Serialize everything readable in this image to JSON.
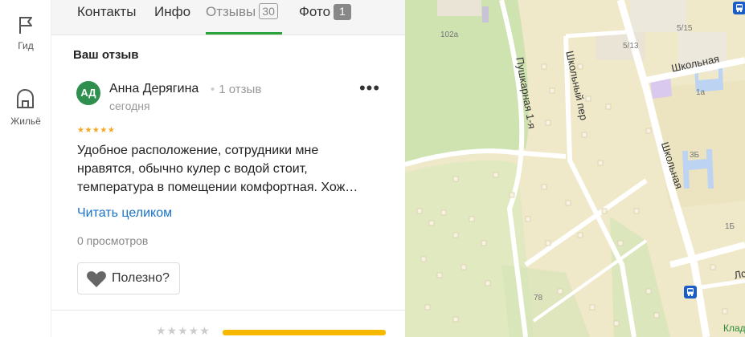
{
  "rail": {
    "items": [
      {
        "label": "Гид",
        "icon": "flag-icon"
      },
      {
        "label": "Жильё",
        "icon": "house-icon"
      }
    ]
  },
  "tabs": [
    {
      "label": "Контакты"
    },
    {
      "label": "Инфо"
    },
    {
      "label": "Отзывы",
      "count": "30",
      "active": true
    },
    {
      "label": "Фото",
      "count": "1"
    }
  ],
  "review": {
    "section_title": "Ваш отзыв",
    "avatar_initials": "АД",
    "author": "Анна Дерягина",
    "author_reviews": "1 отзыв",
    "date": "сегодня",
    "more_icon": "•••",
    "stars": "★★★★★",
    "rating": 5,
    "text_lines": [
      "Удобное расположение, сотрудники мне",
      "нравятся, обычно кулер с водой стоит,",
      "температура в помещении комфортная. Хож…"
    ],
    "read_more": "Читать целиком",
    "views": "0 просмотров",
    "useful_label": "Полезно?"
  },
  "next_review": {
    "stars": "★★★★★"
  },
  "map": {
    "streets": [
      "Пушкарная 1-я",
      "Школьный пер",
      "Школьная",
      "Школьная"
    ],
    "buildings": [
      "102а",
      "5/13",
      "5/15",
      "1а",
      "3Б",
      "1Б",
      "78"
    ],
    "clipped_label": "Лс",
    "clipped_label_2": "Клад",
    "bus_stop_icon": "bus-icon",
    "colors": {
      "ground": "#efe8c9",
      "park": "#cfe3b1",
      "road": "#ffffff"
    }
  },
  "colors": {
    "accent_green": "#2aa33a",
    "link_blue": "#1a73c8",
    "star": "#f5a623"
  }
}
